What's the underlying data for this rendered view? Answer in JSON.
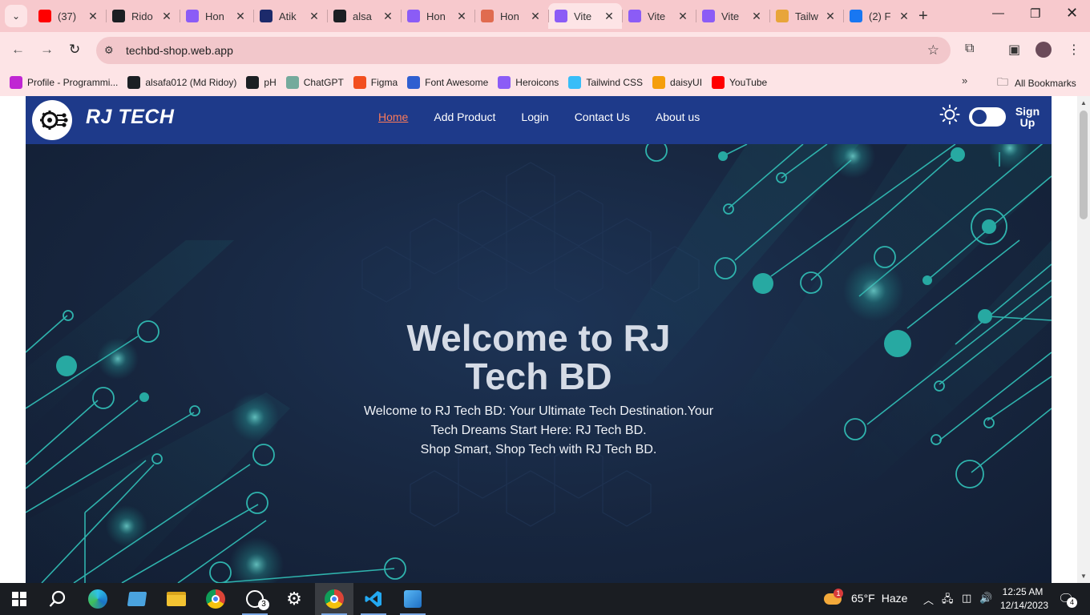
{
  "browser": {
    "tabs": [
      {
        "label": "(37)",
        "icon": "youtube-icon",
        "color": "#ff0000"
      },
      {
        "label": "Rido",
        "icon": "github-icon",
        "color": "#1b1f23"
      },
      {
        "label": "Hon",
        "icon": "vite-icon",
        "color": "#8b5cf6"
      },
      {
        "label": "Atik",
        "icon": "atik-icon",
        "color": "#1c2a6b"
      },
      {
        "label": "alsa",
        "icon": "github-icon",
        "color": "#1b1f23"
      },
      {
        "label": "Hon",
        "icon": "vite-icon",
        "color": "#8b5cf6"
      },
      {
        "label": "Hon",
        "icon": "site-icon",
        "color": "#e06b4f"
      },
      {
        "label": "Vite",
        "icon": "vite-icon",
        "color": "#8b5cf6",
        "active": true
      },
      {
        "label": "Vite",
        "icon": "vite-icon",
        "color": "#8b5cf6"
      },
      {
        "label": "Vite",
        "icon": "vite-icon",
        "color": "#8b5cf6"
      },
      {
        "label": "Tailw",
        "icon": "person-icon",
        "color": "#e8a53a"
      },
      {
        "label": "(2) F",
        "icon": "facebook-icon",
        "color": "#1877f2"
      }
    ],
    "url": "techbd-shop.web.app",
    "bookmarks": [
      {
        "label": "Profile - Programmi...",
        "icon": "programming-hero-icon",
        "color": "#c026d3"
      },
      {
        "label": "alsafa012 (Md Ridoy)",
        "icon": "github-icon",
        "color": "#1b1f23"
      },
      {
        "label": "pH",
        "icon": "github-icon",
        "color": "#1b1f23"
      },
      {
        "label": "ChatGPT",
        "icon": "chatgpt-icon",
        "color": "#74aa9c"
      },
      {
        "label": "Figma",
        "icon": "figma-icon",
        "color": "#f24e1e"
      },
      {
        "label": "Font Awesome",
        "icon": "flag-icon",
        "color": "#2f5fd0"
      },
      {
        "label": "Heroicons",
        "icon": "shield-icon",
        "color": "#8b5cf6"
      },
      {
        "label": "Tailwind CSS",
        "icon": "tailwind-icon",
        "color": "#38bdf8"
      },
      {
        "label": "daisyUI",
        "icon": "daisyui-icon",
        "color": "#f59e0b"
      },
      {
        "label": "YouTube",
        "icon": "youtube-icon",
        "color": "#ff0000"
      }
    ],
    "all_bookmarks": "All Bookmarks"
  },
  "site": {
    "brand": "RJ TECH",
    "nav": [
      {
        "label": "Home",
        "active": true
      },
      {
        "label": "Add Product"
      },
      {
        "label": "Login"
      },
      {
        "label": "Contact Us"
      },
      {
        "label": "About us"
      }
    ],
    "signup": "Sign Up",
    "accent_color": "#1e3a8a",
    "active_link_color": "#fb7a5a",
    "hero": {
      "title": "Welcome to RJ Tech BD",
      "line1": "Welcome to RJ Tech BD: Your Ultimate Tech Destination.Your Tech Dreams Start Here: RJ Tech BD.",
      "line2": "Shop Smart, Shop Tech with RJ Tech BD."
    }
  },
  "taskbar": {
    "weather_temp": "65°F",
    "weather_text": "Haze",
    "weather_badge": "1",
    "time": "12:25 AM",
    "date": "12/14/2023",
    "notifications": "4",
    "whatsapp_badge": "3"
  }
}
